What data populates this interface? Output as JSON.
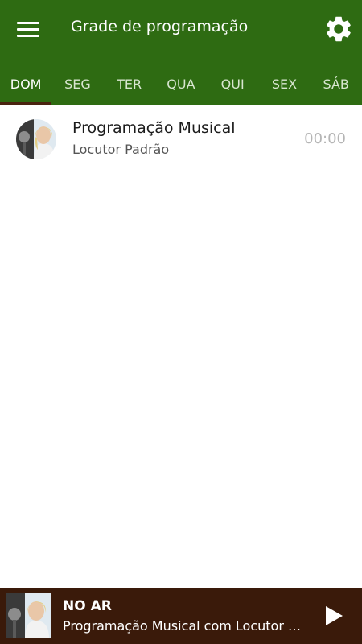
{
  "appbar": {
    "title": "Grade de programação",
    "menu_icon": "hamburger-menu-icon",
    "settings_icon": "gear-icon",
    "background_color": "#2e6b12"
  },
  "tabs": [
    {
      "label": "DOM",
      "active": true
    },
    {
      "label": "SEG",
      "active": false
    },
    {
      "label": "TER",
      "active": false
    },
    {
      "label": "QUA",
      "active": false
    },
    {
      "label": "QUI",
      "active": false
    },
    {
      "label": "SEX",
      "active": false
    },
    {
      "label": "SÁB",
      "active": false
    }
  ],
  "schedule": [
    {
      "title": "Programação Musical",
      "host": "Locutor Padrão",
      "time": "00:00",
      "avatar": "host-photo-avatar"
    }
  ],
  "player": {
    "label": "NO AR",
    "now_playing": "Programação Musical com Locutor Padrão",
    "play_icon": "play-icon",
    "background_color": "#3a1a0a"
  }
}
